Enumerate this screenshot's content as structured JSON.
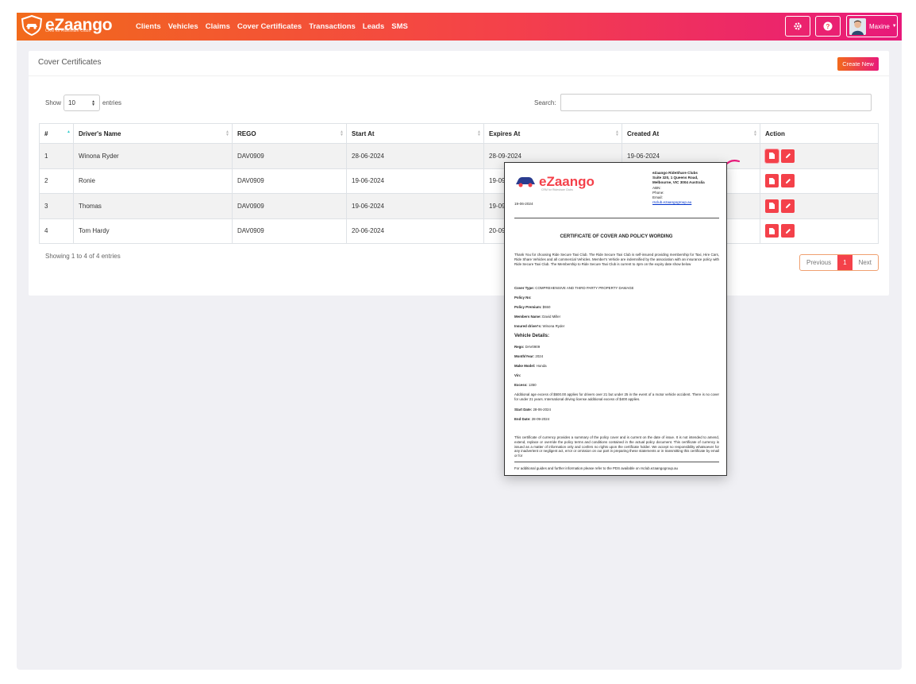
{
  "app": {
    "logo_text": "eZaango",
    "logo_tagline": "CRM for Rideshare Clubs",
    "nav": [
      "Clients",
      "Vehicles",
      "Claims",
      "Cover Certificates",
      "Transactions",
      "Leads",
      "SMS"
    ],
    "user_name": "Maxine",
    "accent_colors": {
      "orange": "#f26a1b",
      "pink": "#e8197a",
      "red": "#f4414a"
    }
  },
  "page": {
    "title": "Cover Certificates",
    "create_label": "Create New",
    "show_label": "Show",
    "entries_value": "10",
    "entries_label": "entries",
    "search_label": "Search:"
  },
  "table": {
    "headers": [
      "#",
      "Driver's Name",
      "REGO",
      "Start At",
      "Expires At",
      "Created At",
      "Action"
    ],
    "rows": [
      [
        "1",
        "Winona Ryder",
        "DAV0909",
        "28-06-2024",
        "28-09-2024",
        "19-06-2024"
      ],
      [
        "2",
        "Ronie",
        "DAV0909",
        "19-06-2024",
        "19-09",
        ""
      ],
      [
        "3",
        "Thomas",
        "DAV0909",
        "19-06-2024",
        "19-09",
        ""
      ],
      [
        "4",
        "Tom Hardy",
        "DAV0909",
        "20-06-2024",
        "20-09",
        ""
      ]
    ],
    "info": "Showing 1 to 4 of 4 entries",
    "pager": {
      "prev": "Previous",
      "current": "1",
      "next": "Next"
    }
  },
  "certificate": {
    "logo_text": "eZaango",
    "logo_tagline": "CRM for Rideshare Clubs",
    "org_name": "eZaango RideShare Clubs",
    "address1": "Suite 320, 1 Queens Road,",
    "address2": "Melbourne, VIC 3004 Australia",
    "abn": "ABN:",
    "phone": "Phone:",
    "email": "Email:",
    "email_link": "rsclub.ezaangogroup.au",
    "date": "19-06-2024",
    "heading": "CERTIFICATE OF COVER AND POLICY WORDING",
    "intro": "Thank You for choosing Ride Secure Taxi Club. The Ride Secure Taxi Club is self-insured providing membership for Taxi, Hire Cars, Ride Share Vehicles and all commercial Vehicles. Member's Vehicle are indemnified by the association with an insurance policy with Ride Secure Taxi Club. The Membership to Ride Secure Taxi Club is current to 4pm on the expiry date show below",
    "cover_type_label": "Cover Type:",
    "cover_type": "COMPREHENSIVE AND THIRD PARTY PROPERTY DAMAGE",
    "policy_no_label": "Policy No:",
    "premium_label": "Policy Premium:",
    "premium": "$550",
    "member_label": "Members Name:",
    "member": "David Miller",
    "insured_label": "Insured driver's:",
    "insured": "Winona Ryder",
    "vehicle_heading": "Vehicle Details:",
    "rego_label": "Rego:",
    "rego": "DAV0909",
    "month_label": "Month/Year:",
    "month": "2024",
    "make_label": "Make Model:",
    "make": "Honda",
    "vin_label": "Vin:",
    "excess_label": "Excess:",
    "excess": "1350",
    "age_text": "Additional age excess of $500.00 applies for drivers over 21 but under 25 in the event of a motor vehicle accident. There is no cover for under 21 years. International driving license additional excess of $400 applies.",
    "start_label": "Start Date:",
    "start": "28-06-2024",
    "end_label": "End Date:",
    "end": "28-09-2024",
    "disclaimer": "This certificate of currency provides a summary of the policy cover and is current on the date of issue. It is not intended to amend, extend, replace or override the policy terms and conditions contained in the actual policy document. This certificate of currency is issued as a matter of information only and confers no rights upon the certificate holder. We accept no responsibility whatsoever for any inadvertent or negligent act, error or omission on our part in preparing these statements or in transmitting this certificate by email or for",
    "footer": "For additional guides and further information please refer to the PDS available on rsclub.ezaangogroup.au"
  }
}
